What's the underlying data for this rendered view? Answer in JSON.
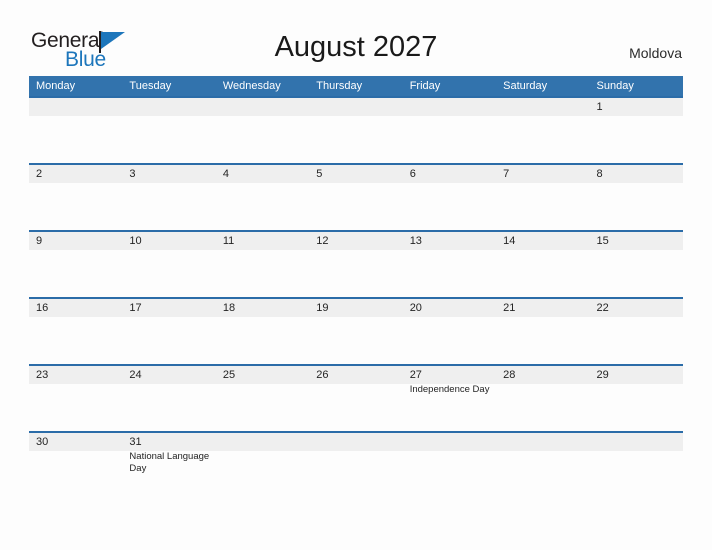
{
  "brand": {
    "name_part1": "General",
    "name_part2": "Blue",
    "color_dark": "#231f20",
    "color_blue": "#1d76bb"
  },
  "header": {
    "title": "August 2027",
    "region": "Moldova"
  },
  "calendar": {
    "month": "August",
    "year": "2027",
    "first_day_of_week": "Monday",
    "accent_color": "#3273ad",
    "row_border_color": "#2b6ca8",
    "band_color": "#efefef",
    "weekday_headers": [
      "Monday",
      "Tuesday",
      "Wednesday",
      "Thursday",
      "Friday",
      "Saturday",
      "Sunday"
    ],
    "weeks": [
      [
        {
          "day": ""
        },
        {
          "day": ""
        },
        {
          "day": ""
        },
        {
          "day": ""
        },
        {
          "day": ""
        },
        {
          "day": ""
        },
        {
          "day": "1"
        }
      ],
      [
        {
          "day": "2"
        },
        {
          "day": "3"
        },
        {
          "day": "4"
        },
        {
          "day": "5"
        },
        {
          "day": "6"
        },
        {
          "day": "7"
        },
        {
          "day": "8"
        }
      ],
      [
        {
          "day": "9"
        },
        {
          "day": "10"
        },
        {
          "day": "11"
        },
        {
          "day": "12"
        },
        {
          "day": "13"
        },
        {
          "day": "14"
        },
        {
          "day": "15"
        }
      ],
      [
        {
          "day": "16"
        },
        {
          "day": "17"
        },
        {
          "day": "18"
        },
        {
          "day": "19"
        },
        {
          "day": "20"
        },
        {
          "day": "21"
        },
        {
          "day": "22"
        }
      ],
      [
        {
          "day": "23"
        },
        {
          "day": "24"
        },
        {
          "day": "25"
        },
        {
          "day": "26"
        },
        {
          "day": "27",
          "event": "Independence Day"
        },
        {
          "day": "28"
        },
        {
          "day": "29"
        }
      ],
      [
        {
          "day": "30"
        },
        {
          "day": "31",
          "event": "National Language Day"
        },
        {
          "day": ""
        },
        {
          "day": ""
        },
        {
          "day": ""
        },
        {
          "day": ""
        },
        {
          "day": ""
        }
      ]
    ]
  }
}
